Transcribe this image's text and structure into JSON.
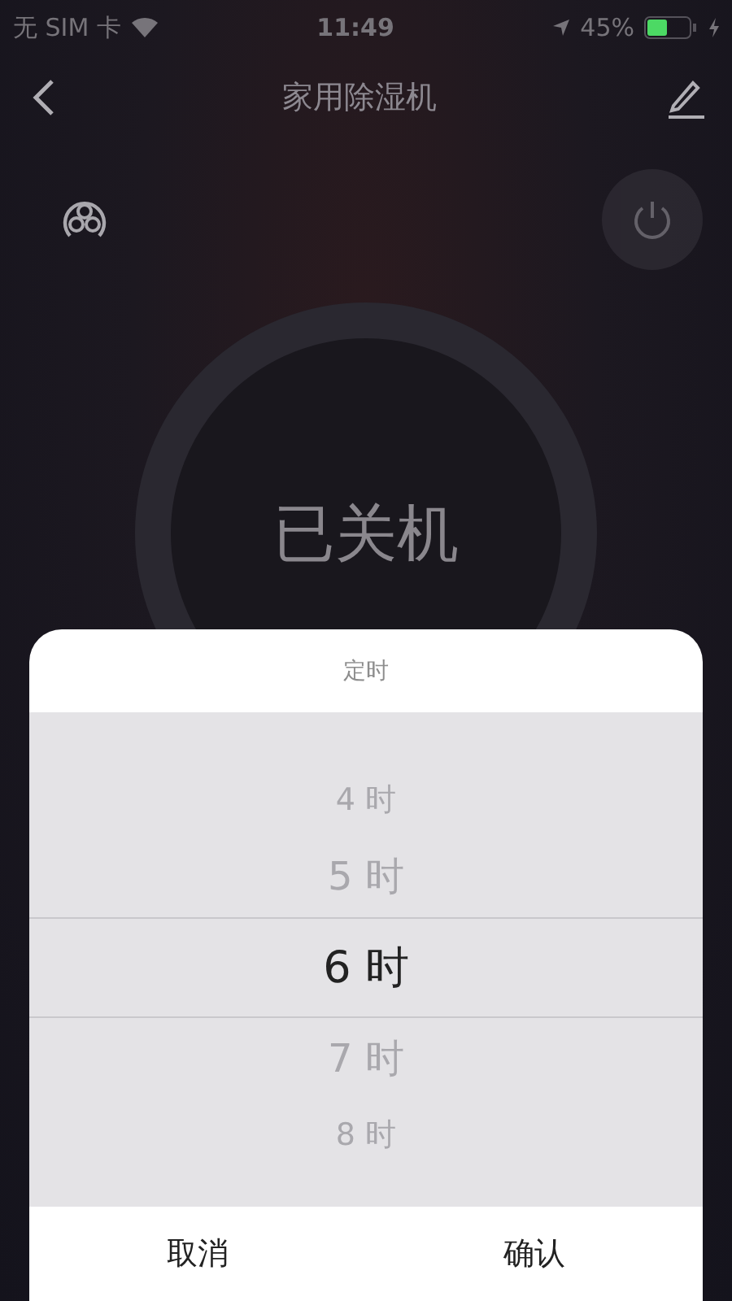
{
  "status_bar": {
    "carrier": "无 SIM 卡",
    "time": "11:49",
    "battery": "45%"
  },
  "header": {
    "title": "家用除湿机"
  },
  "device": {
    "state": "已关机",
    "power_on": false
  },
  "timer_sheet": {
    "title": "定时",
    "options": [
      {
        "label": "4 时",
        "selected": false
      },
      {
        "label": "5 时",
        "selected": false
      },
      {
        "label": "6 时",
        "selected": true
      },
      {
        "label": "7 时",
        "selected": false
      },
      {
        "label": "8 时",
        "selected": false
      }
    ],
    "buttons": [
      {
        "label": "取消"
      },
      {
        "label": "确认"
      }
    ]
  }
}
